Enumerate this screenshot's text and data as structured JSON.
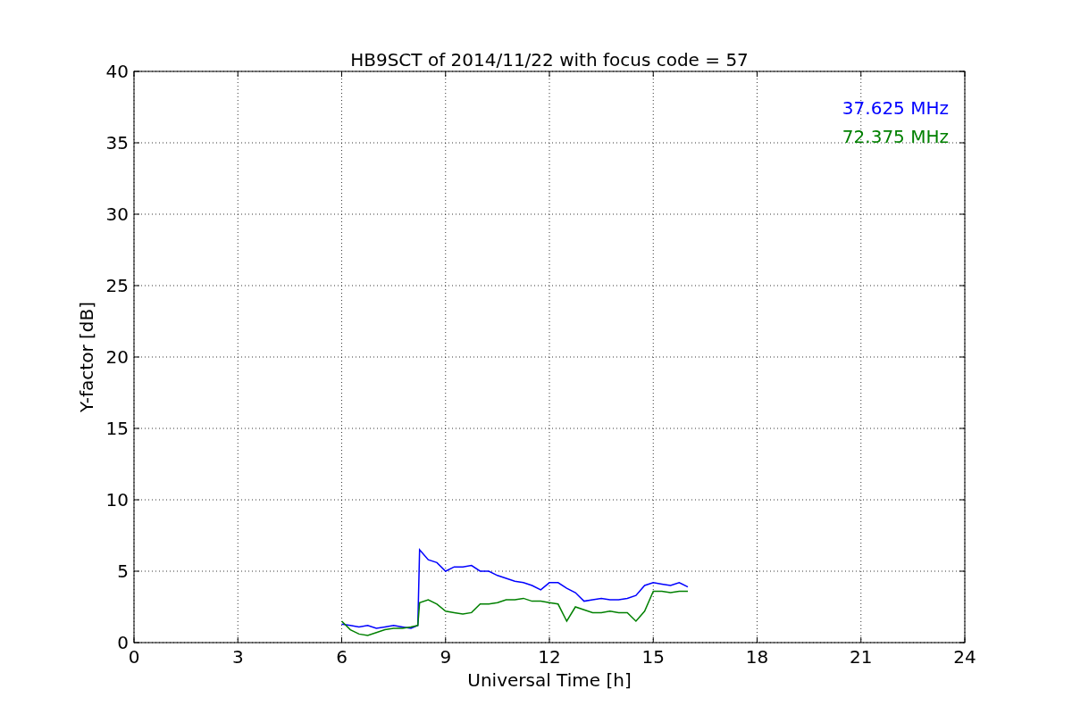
{
  "figure": {
    "chart_data": {
      "type": "line",
      "title": "HB9SCT of 2014/11/22 with focus code = 57",
      "xlabel": "Universal Time [h]",
      "ylabel": "Y-factor [dB]",
      "x": [
        6.0,
        6.25,
        6.5,
        6.75,
        7.0,
        7.25,
        7.5,
        7.75,
        8.0,
        8.2,
        8.25,
        8.5,
        8.75,
        9.0,
        9.25,
        9.5,
        9.75,
        10.0,
        10.25,
        10.5,
        10.75,
        11.0,
        11.25,
        11.5,
        11.75,
        12.0,
        12.25,
        12.5,
        12.75,
        13.0,
        13.25,
        13.5,
        13.75,
        14.0,
        14.25,
        14.5,
        14.75,
        15.0,
        15.25,
        15.5,
        15.75,
        16.0
      ],
      "series": [
        {
          "name": "37.625 MHz",
          "color": "#0000ff",
          "values": [
            1.3,
            1.2,
            1.1,
            1.2,
            1.0,
            1.1,
            1.2,
            1.1,
            1.0,
            1.2,
            6.5,
            5.8,
            5.6,
            5.0,
            5.3,
            5.3,
            5.4,
            5.0,
            5.0,
            4.7,
            4.5,
            4.3,
            4.2,
            4.0,
            3.7,
            4.2,
            4.2,
            3.8,
            3.5,
            2.9,
            3.0,
            3.1,
            3.0,
            3.0,
            3.1,
            3.3,
            4.0,
            4.2,
            4.1,
            4.0,
            4.2,
            3.9
          ]
        },
        {
          "name": "72.375 MHz",
          "color": "#008000",
          "values": [
            1.5,
            0.9,
            0.6,
            0.5,
            0.7,
            0.9,
            1.0,
            1.0,
            1.1,
            1.2,
            2.8,
            3.0,
            2.7,
            2.2,
            2.1,
            2.0,
            2.1,
            2.7,
            2.7,
            2.8,
            3.0,
            3.0,
            3.1,
            2.9,
            2.9,
            2.8,
            2.7,
            1.5,
            2.5,
            2.3,
            2.1,
            2.1,
            2.2,
            2.1,
            2.1,
            1.5,
            2.2,
            3.6,
            3.6,
            3.5,
            3.6,
            3.6
          ]
        }
      ],
      "xlim": [
        0,
        24
      ],
      "ylim": [
        0,
        40
      ],
      "xticks": [
        0,
        3,
        6,
        9,
        12,
        15,
        18,
        21,
        24
      ],
      "yticks": [
        0,
        5,
        10,
        15,
        20,
        25,
        30,
        35,
        40
      ],
      "grid": true
    }
  }
}
